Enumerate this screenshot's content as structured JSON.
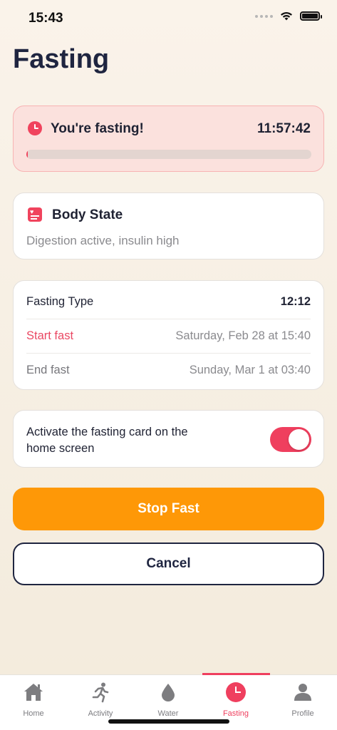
{
  "status_bar": {
    "time": "15:43"
  },
  "page": {
    "title": "Fasting"
  },
  "banner": {
    "label": "You're fasting!",
    "timer": "11:57:42",
    "progress_fraction": 0.005
  },
  "body_state": {
    "title": "Body State",
    "description": "Digestion active, insulin high"
  },
  "fasting_info": {
    "type_label": "Fasting Type",
    "type_value": "12:12",
    "start_label": "Start fast",
    "start_value": "Saturday, Feb 28 at 15:40",
    "end_label": "End fast",
    "end_value": "Sunday, Mar 1 at 03:40"
  },
  "home_card_toggle": {
    "label": "Activate the fasting card on the home screen",
    "enabled": true
  },
  "actions": {
    "stop_label": "Stop Fast",
    "cancel_label": "Cancel"
  },
  "tab_bar": {
    "active": "Fasting",
    "tabs": [
      {
        "label": "Home",
        "icon": "home-icon"
      },
      {
        "label": "Activity",
        "icon": "running-icon"
      },
      {
        "label": "Water",
        "icon": "water-drop-icon"
      },
      {
        "label": "Fasting",
        "icon": "clock-icon"
      },
      {
        "label": "Profile",
        "icon": "person-icon"
      }
    ]
  },
  "colors": {
    "accent": "#ef3f5e",
    "orange": "#fe9807",
    "navy": "#1f2540"
  }
}
